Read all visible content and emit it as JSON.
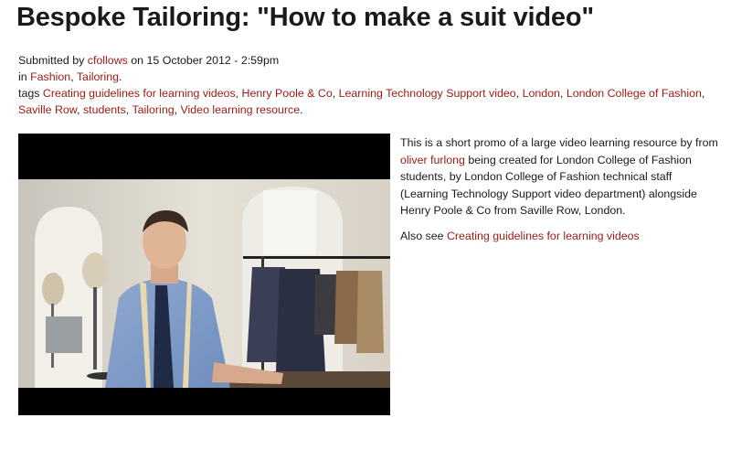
{
  "post": {
    "title": "Bespoke Tailoring: \"How to make a suit video\"",
    "submitted_prefix": "Submitted by ",
    "author": "cfollows",
    "date_text": " on 15 October 2012 - 2:59pm",
    "in_prefix": "in ",
    "categories": [
      "Fashion",
      "Tailoring"
    ],
    "tags_prefix": "tags ",
    "tags": [
      "Creating guidelines for learning videos",
      "Henry Poole & Co",
      "Learning Technology Support video",
      "London",
      "London College of Fashion",
      "Saville Row",
      "students",
      "Tailoring",
      "Video learning resource"
    ]
  },
  "body": {
    "p1_a": "This is a short promo of a large video learning resource by from ",
    "p1_link": "oliver furlong",
    "p1_b": " being created for London College of Fashion students, by London College of Fashion technical staff (Learning Technology Support video department) alongside Henry Poole & Co from Saville Row, London.",
    "p2_a": "Also see ",
    "p2_link": "Creating guidelines for learning videos"
  },
  "colors": {
    "link": "#9a1b12",
    "text": "#1a1a1a",
    "video_bg": "#000000"
  }
}
